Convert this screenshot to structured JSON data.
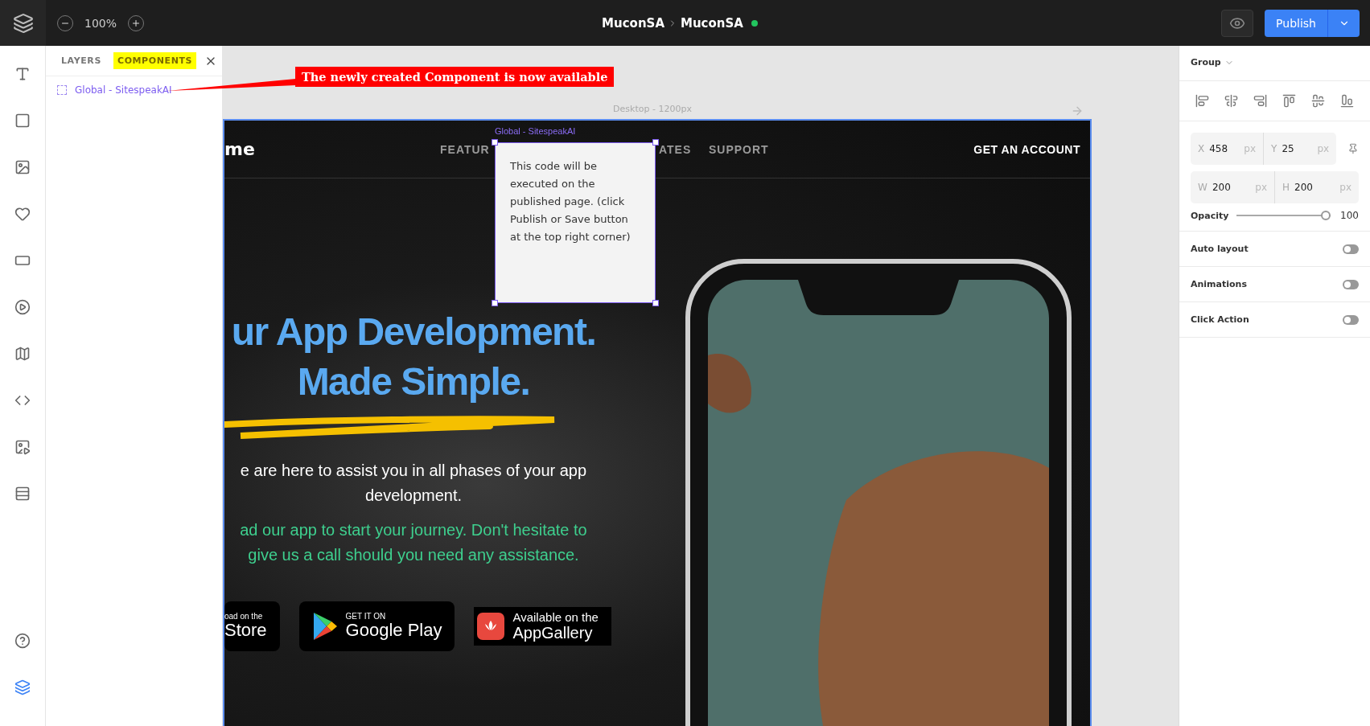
{
  "toolbar": {
    "zoom": "100%",
    "breadcrumb": [
      "MuconSA",
      "MuconSA"
    ],
    "saved": true,
    "publish_button": "Publish"
  },
  "panel": {
    "tabs": [
      {
        "label": "LAYERS",
        "selected": false
      },
      {
        "label": "COMPONENTS",
        "selected": true
      }
    ],
    "items": [
      {
        "label": "Global - SitespeakAI"
      }
    ]
  },
  "annotation": {
    "text": "The newly created Component is now available"
  },
  "canvas": {
    "frame_label": "Desktop - 1200px",
    "site": {
      "logo": "me",
      "nav": [
        {
          "label": "FEATUR"
        },
        {
          "label": "ATES"
        },
        {
          "label": "SUPPORT"
        }
      ],
      "cta": "GET AN ACCOUNT",
      "heading": [
        "ur App Development.",
        "Made Simple."
      ],
      "intro": "e are here to assist you in all phases of your app development.",
      "note": "ad our app to start your journey. Don't hesitate to give us a call should you need any assistance.",
      "stores": [
        {
          "kind": "apple",
          "small": "oad on the",
          "large": "Store"
        },
        {
          "kind": "google",
          "small": "GET IT ON",
          "large": "Google Play"
        },
        {
          "kind": "huawei",
          "small": "Available on the",
          "large": "AppGallery"
        }
      ]
    },
    "component": {
      "label": "Global - SitespeakAI",
      "text": "This code will be executed on the published page. (click Publish or Save button at the top right corner)"
    }
  },
  "properties": {
    "type": "Group",
    "fields": [
      [
        {
          "label": "X",
          "value": "458",
          "unit": "px"
        },
        {
          "label": "Y",
          "value": "25",
          "unit": "px"
        }
      ],
      [
        {
          "label": "W",
          "value": "200",
          "unit": "px"
        },
        {
          "label": "H",
          "value": "200",
          "unit": "px"
        }
      ]
    ],
    "opacity": {
      "label": "Opacity",
      "level": 1,
      "reading": "100"
    },
    "toggles": [
      {
        "label": "Auto layout",
        "on": false
      },
      {
        "label": "Animations",
        "on": false
      },
      {
        "label": "Click Action",
        "on": false
      }
    ]
  }
}
